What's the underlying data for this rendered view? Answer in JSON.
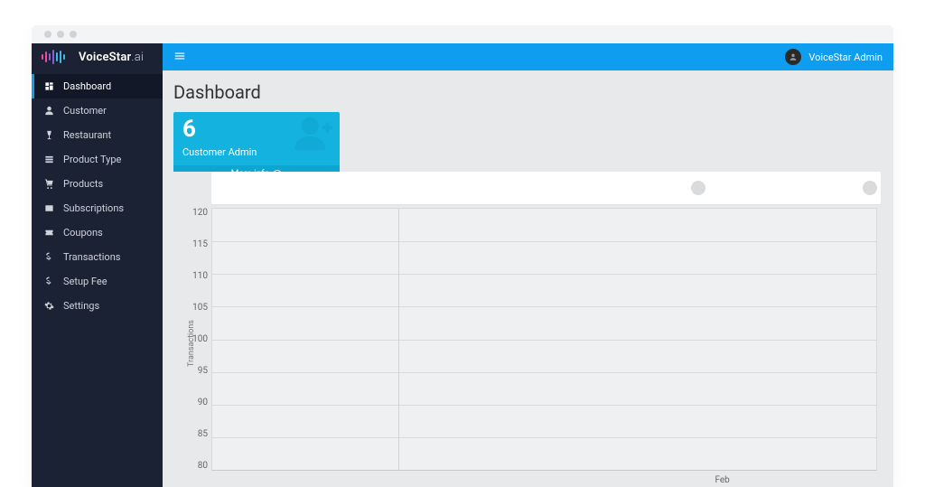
{
  "brand": {
    "name_a": "VoiceStar",
    "name_b": ".ai"
  },
  "sidebar": {
    "items": [
      {
        "label": "Dashboard"
      },
      {
        "label": "Customer"
      },
      {
        "label": "Restaurant"
      },
      {
        "label": "Product Type"
      },
      {
        "label": "Products"
      },
      {
        "label": "Subscriptions"
      },
      {
        "label": "Coupons"
      },
      {
        "label": "Transactions"
      },
      {
        "label": "Setup Fee"
      },
      {
        "label": "Settings"
      }
    ]
  },
  "topbar": {
    "user_name": "VoiceStar Admin"
  },
  "page": {
    "title": "Dashboard"
  },
  "card": {
    "count": "6",
    "label": "Customer Admin",
    "footer": "More info"
  },
  "chart_header": {
    "label": ""
  },
  "x_ticks": {
    "feb": "Feb"
  },
  "chart_data": {
    "type": "line",
    "title": "",
    "xlabel": "",
    "ylabel": "Transactions",
    "ylim": [
      80,
      120
    ],
    "y_ticks": [
      "120",
      "115",
      "110",
      "105",
      "100",
      "95",
      "90",
      "85",
      "80"
    ],
    "categories": [
      "Feb"
    ],
    "series": [
      {
        "name": "Transactions",
        "values": []
      }
    ]
  }
}
